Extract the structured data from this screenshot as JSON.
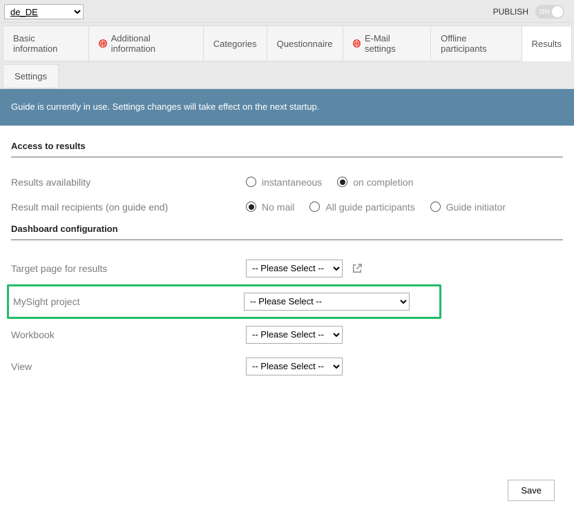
{
  "topbar": {
    "locale_selected": "de_DE",
    "publish_label": "PUBLISH",
    "toggle_text": "ON"
  },
  "tabs": [
    {
      "label": "Basic information",
      "hasGlobe": false,
      "active": false
    },
    {
      "label": "Additional information",
      "hasGlobe": true,
      "active": false
    },
    {
      "label": "Categories",
      "hasGlobe": false,
      "active": false
    },
    {
      "label": "Questionnaire",
      "hasGlobe": false,
      "active": false
    },
    {
      "label": "E-Mail settings",
      "hasGlobe": true,
      "active": false
    },
    {
      "label": "Offline participants",
      "hasGlobe": false,
      "active": false
    },
    {
      "label": "Results",
      "hasGlobe": false,
      "active": true
    }
  ],
  "subtabs": [
    {
      "label": "Settings"
    }
  ],
  "notice": "Guide is currently in use. Settings changes will take effect on the next startup.",
  "sections": {
    "access_heading": "Access to results",
    "dashboard_heading": "Dashboard configuration",
    "rows": {
      "results_availability": {
        "label": "Results availability",
        "options": [
          {
            "label": "instantaneous",
            "checked": false
          },
          {
            "label": "on completion",
            "checked": true
          }
        ]
      },
      "result_mail": {
        "label": "Result mail recipients (on guide end)",
        "options": [
          {
            "label": "No mail",
            "checked": true
          },
          {
            "label": "All guide participants",
            "checked": false
          },
          {
            "label": "Guide initiator",
            "checked": false
          }
        ]
      },
      "target_page": {
        "label": "Target page for results",
        "selected": "-- Please Select --"
      },
      "mysight": {
        "label": "MySight project",
        "selected": "-- Please Select --"
      },
      "workbook": {
        "label": "Workbook",
        "selected": "-- Please Select --"
      },
      "view": {
        "label": "View",
        "selected": "-- Please Select --"
      }
    }
  },
  "buttons": {
    "save": "Save"
  }
}
